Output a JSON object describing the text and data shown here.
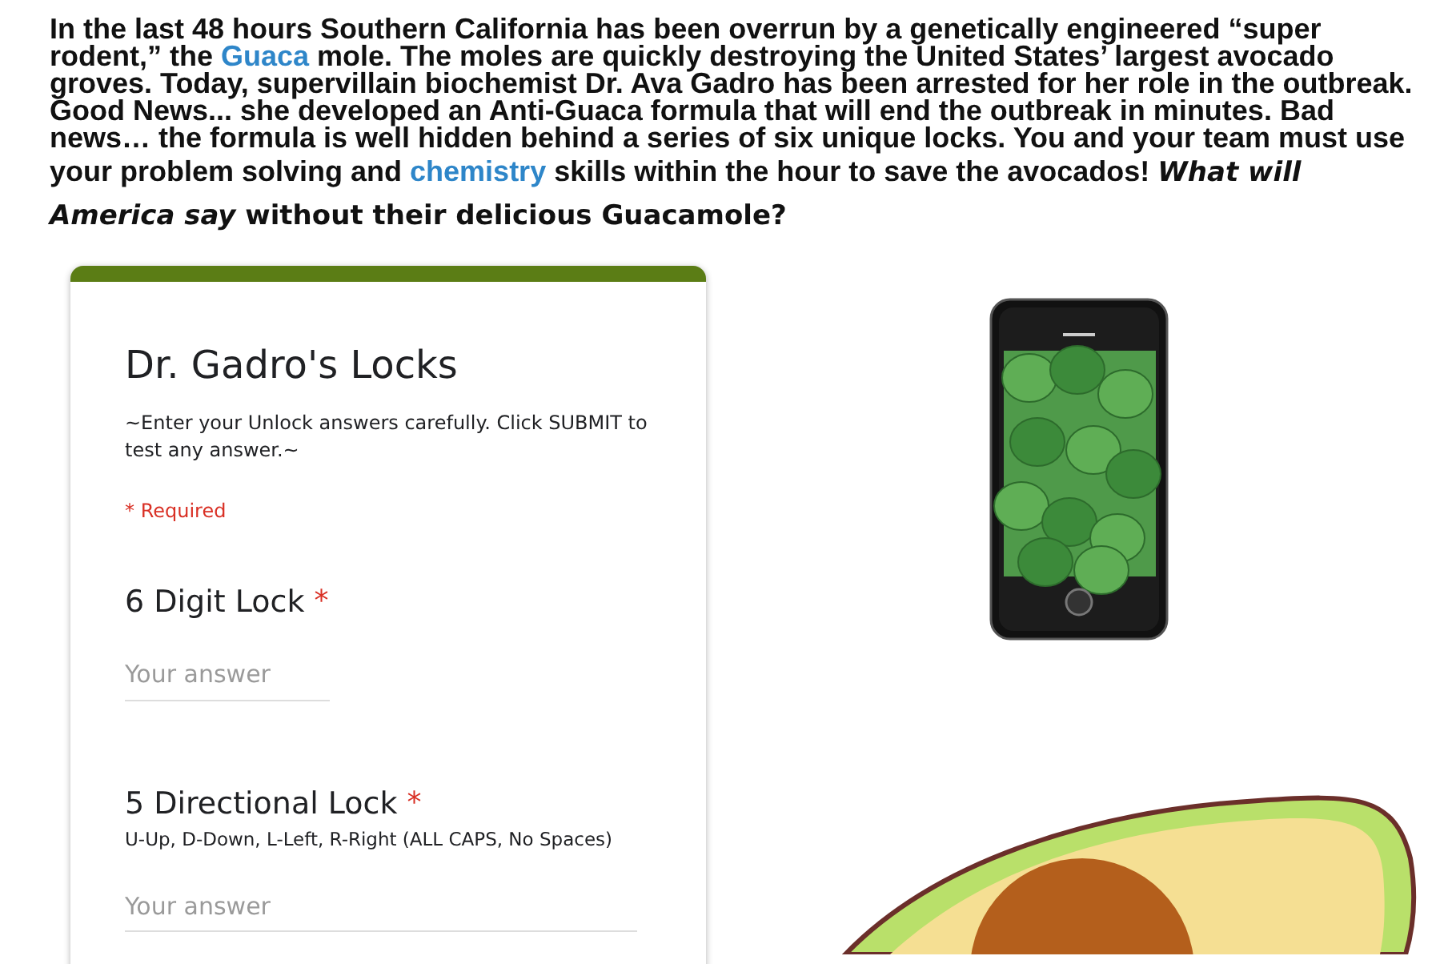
{
  "intro": [
    {
      "kind": "text",
      "text": "In the last 48 hours Southern California has been overrun by a genetically engineered “super rodent,” the "
    },
    {
      "kind": "link",
      "text": "Guaca"
    },
    {
      "kind": "text",
      "text": " mole. The moles are quickly destroying the United States’ largest avocado groves. Today, supervillain biochemist Dr. Ava Gadro has been arrested for her role in the outbreak. Good News... she developed an Anti-Guaca formula that will end the outbreak in minutes. Bad news… the formula is well hidden behind a series of six unique locks. You and your team must use your problem solving and "
    },
    {
      "kind": "link",
      "text": "chemistry"
    },
    {
      "kind": "text",
      "text": " skills within the hour to save the avocados! "
    },
    {
      "kind": "tail",
      "text": "*What will America say* without their delicious Guacamole?"
    }
  ],
  "form": {
    "title": "Dr. Gadro's Locks",
    "description": "~Enter your Unlock answers carefully. Click SUBMIT to test any answer.~",
    "required_note": "* Required",
    "questions": [
      {
        "label": "6 Digit Lock",
        "required_mark": "*",
        "placeholder": "Your answer"
      },
      {
        "label": "5 Directional Lock",
        "required_mark": "*",
        "help": "U-Up, D-Down, L-Left, R-Right (ALL CAPS, No Spaces)",
        "placeholder": "Your answer"
      }
    ]
  }
}
